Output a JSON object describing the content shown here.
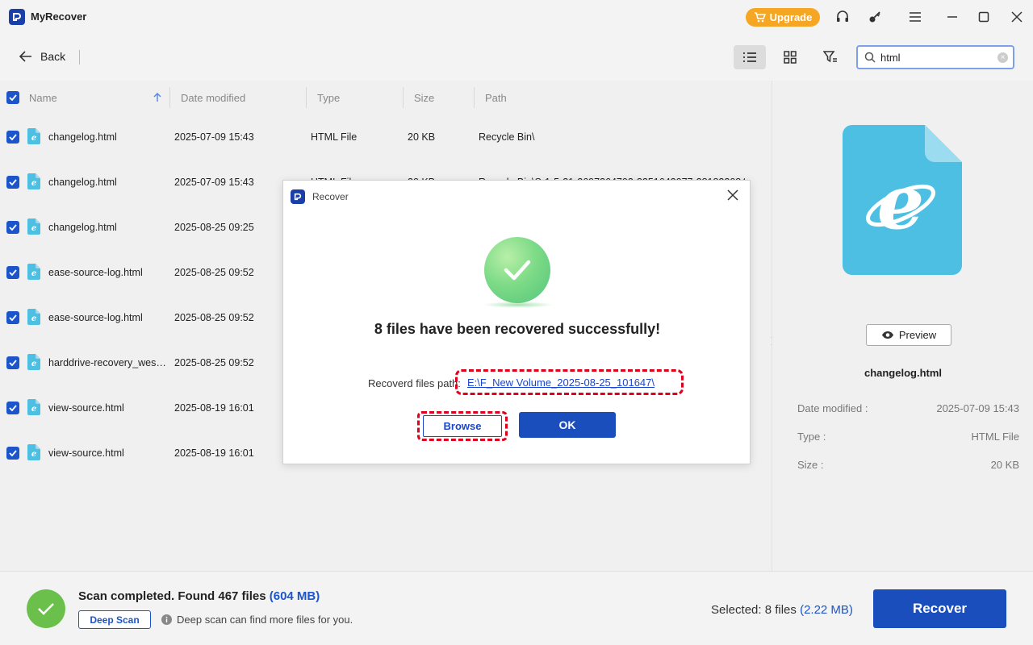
{
  "app": {
    "name": "MyRecover",
    "upgrade_label": "Upgrade"
  },
  "toolbar": {
    "back_label": "Back",
    "search_value": "html"
  },
  "columns": {
    "name": "Name",
    "date": "Date modified",
    "type": "Type",
    "size": "Size",
    "path": "Path"
  },
  "rows": [
    {
      "name": "changelog.html",
      "date": "2025-07-09 15:43",
      "type": "HTML File",
      "size": "20 KB",
      "path": "Recycle Bin\\"
    },
    {
      "name": "changelog.html",
      "date": "2025-07-09 15:43",
      "type": "HTML File",
      "size": "20 KB",
      "path": "Recycle Bin\\S-1-5-21-2697364702-3251642077-281822084-500\\"
    },
    {
      "name": "changelog.html",
      "date": "2025-08-25 09:25",
      "type": "",
      "size": "",
      "path": ""
    },
    {
      "name": "ease-source-log.html",
      "date": "2025-08-25 09:52",
      "type": "",
      "size": "",
      "path": ""
    },
    {
      "name": "ease-source-log.html",
      "date": "2025-08-25 09:52",
      "type": "",
      "size": "",
      "path": ""
    },
    {
      "name": "harddrive-recovery_western-digital.html",
      "date": "2025-08-25 09:52",
      "type": "",
      "size": "",
      "path": ""
    },
    {
      "name": "view-source.html",
      "date": "2025-08-19 16:01",
      "type": "",
      "size": "",
      "path": ""
    },
    {
      "name": "view-source.html",
      "date": "2025-08-19 16:01",
      "type": "",
      "size": "",
      "path": ""
    }
  ],
  "preview": {
    "button_label": "Preview",
    "file_name": "changelog.html",
    "date_label": "Date modified :",
    "date_value": "2025-07-09 15:43",
    "type_label": "Type :",
    "type_value": "HTML File",
    "size_label": "Size :",
    "size_value": "20 KB"
  },
  "bottom": {
    "scan_text": "Scan completed. Found 467 files",
    "scan_size": "(604 MB)",
    "deep_scan_label": "Deep Scan",
    "deep_hint": "Deep scan can find more files for you.",
    "selected_text": "Selected: 8 files",
    "selected_size": "(2.22 MB)",
    "recover_label": "Recover"
  },
  "dialog": {
    "title": "Recover",
    "message": "8 files have been recovered successfully!",
    "path_label": "Recoverd files path:",
    "path_value": "E:\\F_New Volume_2025-08-25_101647\\",
    "browse_label": "Browse",
    "ok_label": "OK"
  },
  "colors": {
    "accent": "#1b4ebd",
    "upgrade": "#f5a623",
    "highlight": "#e0001b",
    "success": "#6ac04a"
  }
}
